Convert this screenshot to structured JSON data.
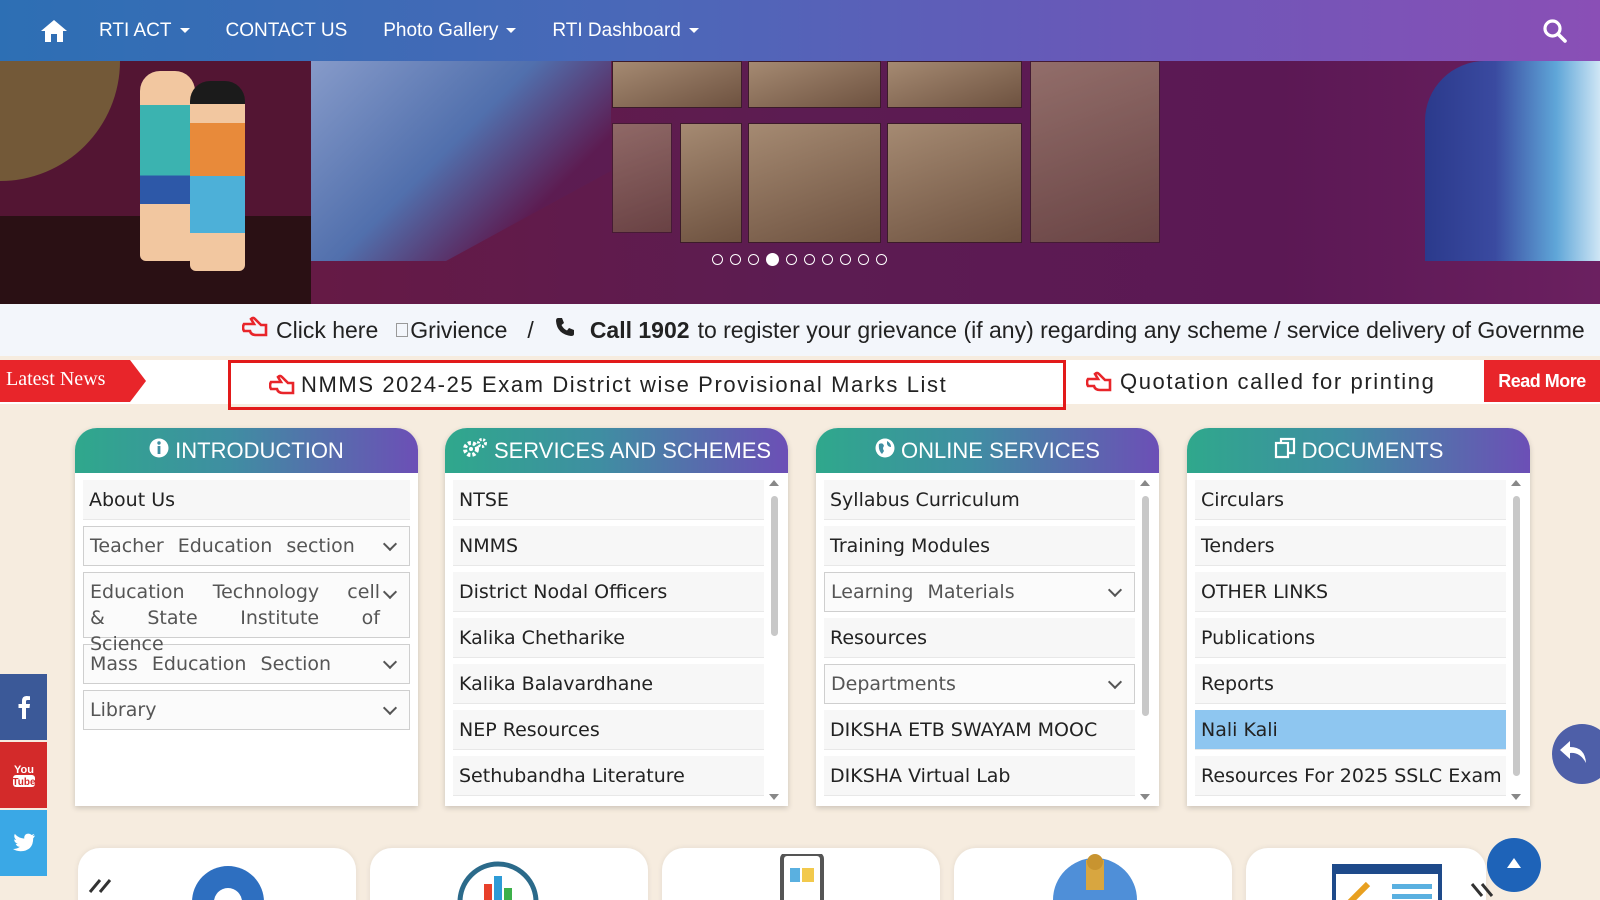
{
  "nav": {
    "items": [
      {
        "label": "RTI ACT",
        "dropdown": true
      },
      {
        "label": "CONTACT US",
        "dropdown": false
      },
      {
        "label": "Photo Gallery",
        "dropdown": true
      },
      {
        "label": "RTI Dashboard",
        "dropdown": true
      }
    ],
    "icons": [
      "home-icon",
      "search-icon"
    ]
  },
  "banner": {
    "slide_count": 10,
    "active_slide": 4
  },
  "grievance": {
    "click_here": "Click here",
    "grievance_img_alt": "Grivience",
    "separator": "/",
    "call": "Call 1902",
    "message": "to register your grievance (if any) regarding any scheme / service delivery of Governme"
  },
  "news": {
    "tag": "Latest News",
    "headline": "NMMS 2024-25 Exam District wise Provisional Marks List",
    "next": "Quotation called for printing",
    "read_more": "Read More"
  },
  "cards": {
    "introduction": {
      "title": "INTRODUCTION",
      "items": [
        {
          "label": "About Us"
        },
        {
          "label": "Teacher Education section"
        },
        {
          "label": "Education Technology cell & State Institute of Science"
        },
        {
          "label": "Mass Education Section"
        },
        {
          "label": "Library"
        }
      ]
    },
    "services": {
      "title": "SERVICES AND SCHEMES",
      "items": [
        "NTSE",
        "NMMS",
        "District Nodal Officers",
        "Kalika Chetharike",
        "Kalika Balavardhane",
        "NEP Resources",
        "Sethubandha Literature"
      ]
    },
    "online": {
      "title": "ONLINE SERVICES",
      "items": [
        {
          "label": "Syllabus Curriculum"
        },
        {
          "label": "Training Modules"
        },
        {
          "label": "Learning Materials"
        },
        {
          "label": "Resources"
        },
        {
          "label": "Departments"
        },
        {
          "label": "DIKSHA ETB SWAYAM MOOC"
        },
        {
          "label": "DIKSHA Virtual Lab"
        }
      ]
    },
    "documents": {
      "title": "DOCUMENTS",
      "items": [
        "Circulars",
        "Tenders",
        "OTHER LINKS",
        "Publications",
        "Reports",
        "Nali Kali",
        "Resources For 2025 SSLC Exam"
      ],
      "selected": "Nali Kali"
    }
  },
  "social": [
    "facebook-icon",
    "youtube-icon",
    "twitter-icon"
  ],
  "colors": {
    "nav_start": "#2d6fb4",
    "nav_end": "#8a4fb6",
    "news_red": "#e8252a",
    "card_head_start": "#2fa88c",
    "card_head_end": "#6c4fb6",
    "selected_row": "#8ec6f0",
    "facebook": "#3b5998",
    "youtube": "#d32a2a",
    "twitter": "#3aa8e6"
  }
}
